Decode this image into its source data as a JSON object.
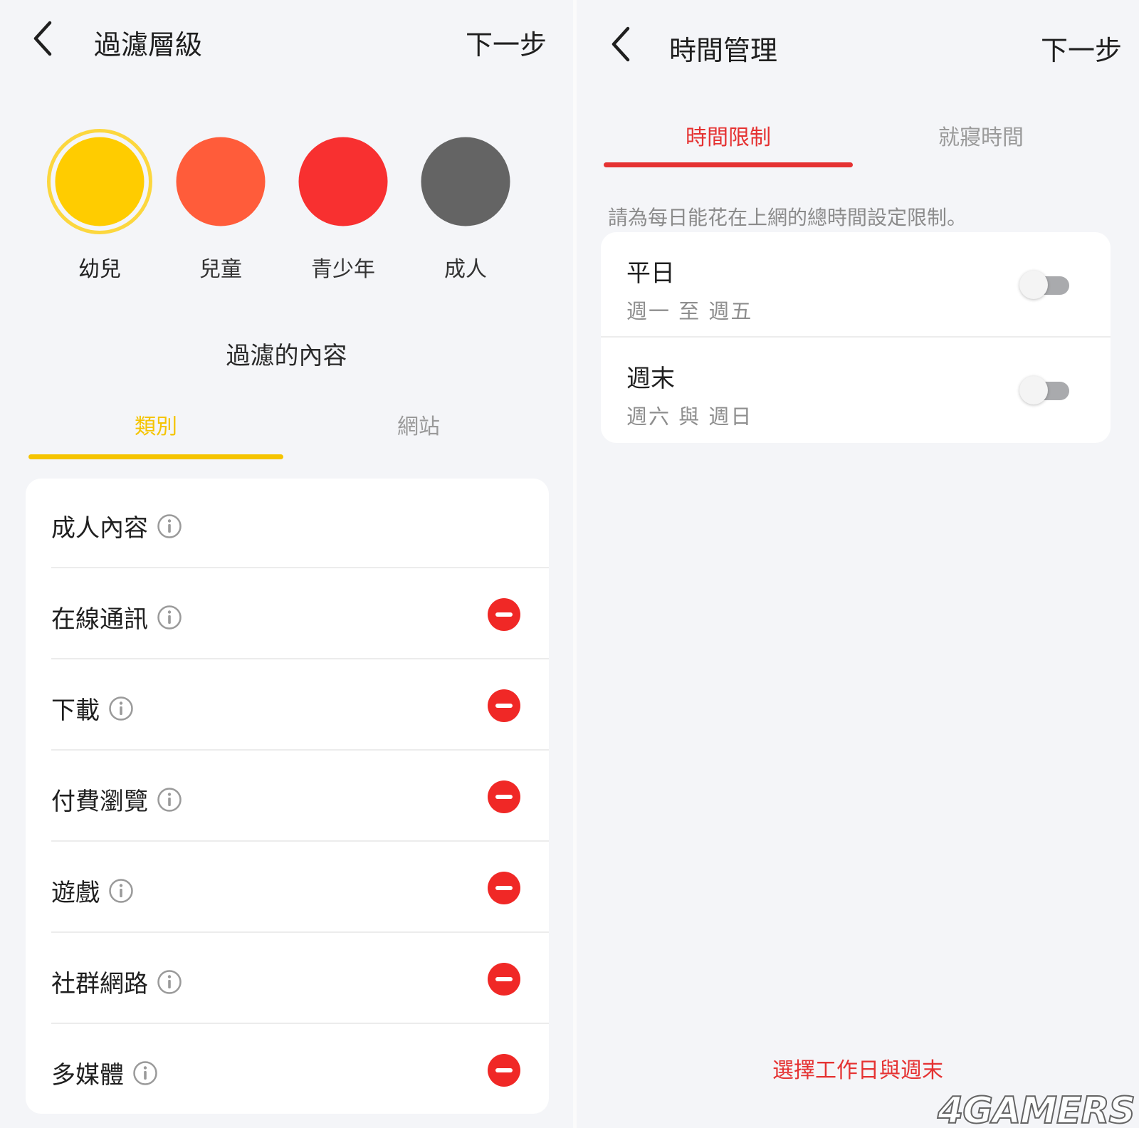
{
  "left": {
    "title": "過濾層級",
    "next": "下一步",
    "levels": [
      {
        "label": "幼兒",
        "color": "#ffcc00",
        "selected": true
      },
      {
        "label": "兒童",
        "color": "#ff5c3a",
        "selected": false
      },
      {
        "label": "青少年",
        "color": "#f83030",
        "selected": false
      },
      {
        "label": "成人",
        "color": "#646464",
        "selected": false
      }
    ],
    "section_title": "過濾的內容",
    "tabs": [
      {
        "label": "類別",
        "active": true
      },
      {
        "label": "網站",
        "active": false
      }
    ],
    "accent": "#f5c400",
    "categories": [
      {
        "label": "成人內容",
        "blocked": false
      },
      {
        "label": "在線通訊",
        "blocked": true
      },
      {
        "label": "下載",
        "blocked": true
      },
      {
        "label": "付費瀏覽",
        "blocked": true
      },
      {
        "label": "遊戲",
        "blocked": true
      },
      {
        "label": "社群網路",
        "blocked": true
      },
      {
        "label": "多媒體",
        "blocked": true
      }
    ]
  },
  "right": {
    "title": "時間管理",
    "next": "下一步",
    "tabs": [
      {
        "label": "時間限制",
        "active": true
      },
      {
        "label": "就寢時間",
        "active": false
      }
    ],
    "accent": "#e53232",
    "note": "請為每日能花在上網的總時間設定限制。",
    "schedules": [
      {
        "label": "平日",
        "sub": "週一 至 週五",
        "enabled": false
      },
      {
        "label": "週末",
        "sub": "週六 與 週日",
        "enabled": false
      }
    ],
    "bottom_link": "選擇工作日與週末"
  },
  "watermark": "4GAMERS"
}
